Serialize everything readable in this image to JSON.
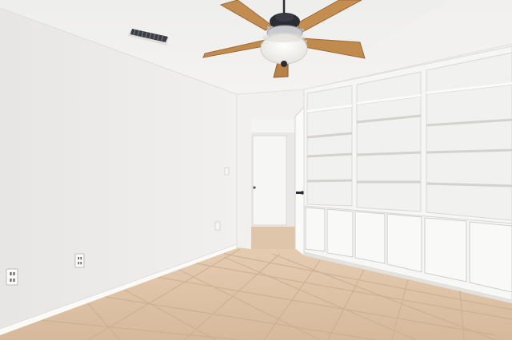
{
  "scene": {
    "subject": "empty-room-with-ceiling-fan-and-built-in-shelves",
    "icons": [
      "ceiling-fan-icon",
      "air-vent-icon",
      "electrical-outlet-icon",
      "door-handle-icon"
    ],
    "colors": {
      "wall": "#f0efed",
      "wall_shadow": "#e4e3e1",
      "ceiling": "#f2f1ef",
      "floor": "#dcc2a6",
      "floor_grout": "#c9ad8f",
      "cabinet": "#f7f7f6",
      "cabinet_edge": "#d6d5d2",
      "fan_blade": "#c38c4f",
      "fan_motor": "#2c2c34",
      "light_glass": "#fbfbf8",
      "vent": "#3a3d44",
      "baseboard": "#fbfbfa"
    }
  }
}
